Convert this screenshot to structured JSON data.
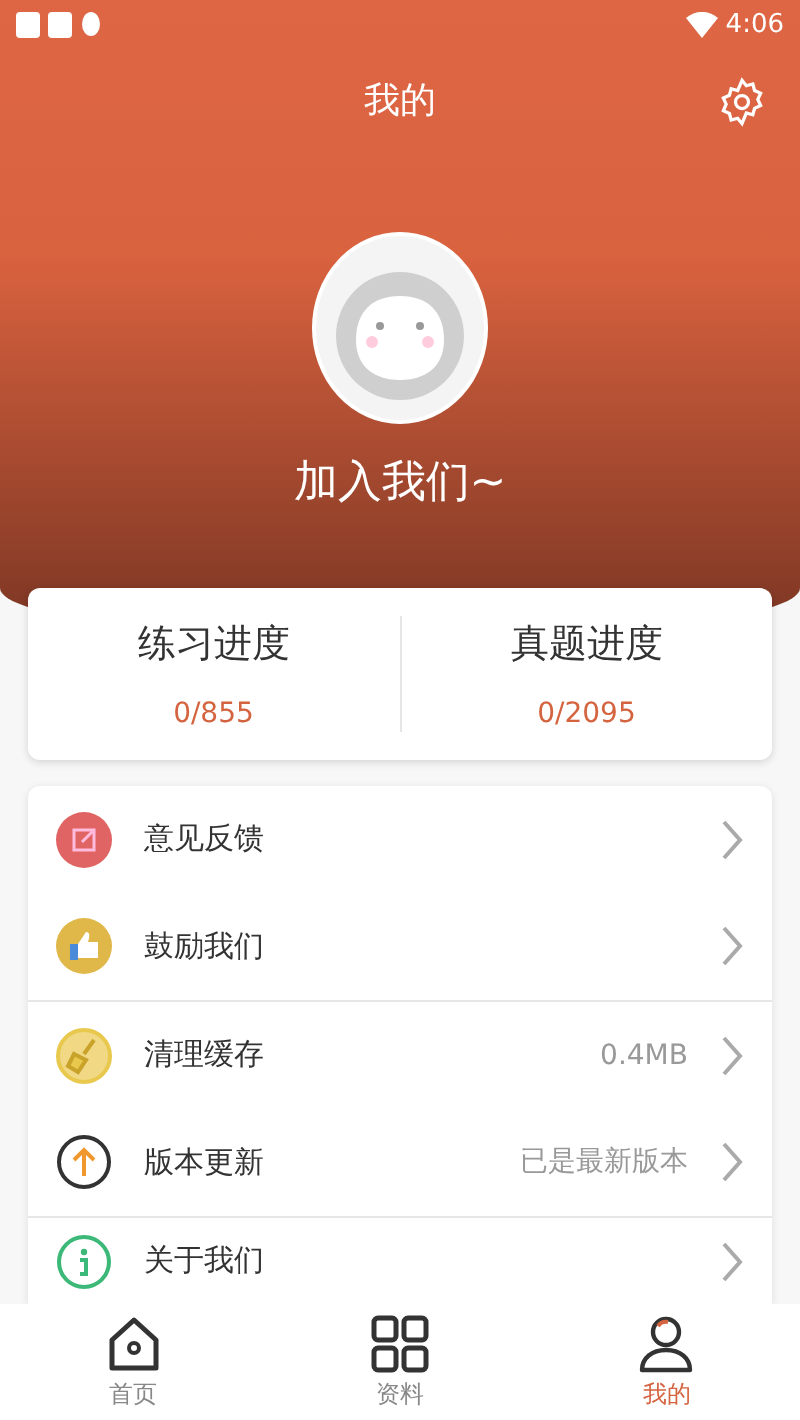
{
  "status_bar": {
    "time": "4:06"
  },
  "header": {
    "title": "我的"
  },
  "profile": {
    "name": "加入我们~"
  },
  "stats": [
    {
      "label": "练习进度",
      "value": "0/855"
    },
    {
      "label": "真题进度",
      "value": "0/2095"
    }
  ],
  "menu_groups": [
    [
      {
        "kind": "feedback",
        "label": "意见反馈"
      },
      {
        "kind": "like",
        "label": "鼓励我们"
      }
    ],
    [
      {
        "kind": "clean",
        "label": "清理缓存",
        "value": "0.4MB"
      },
      {
        "kind": "update",
        "label": "版本更新",
        "value": "已是最新版本"
      }
    ],
    [
      {
        "kind": "about",
        "label": "关于我们"
      }
    ]
  ],
  "tabs": [
    {
      "kind": "home",
      "label": "首页",
      "selected": false
    },
    {
      "kind": "grid",
      "label": "资料",
      "selected": false
    },
    {
      "kind": "person",
      "label": "我的",
      "selected": true
    }
  ]
}
